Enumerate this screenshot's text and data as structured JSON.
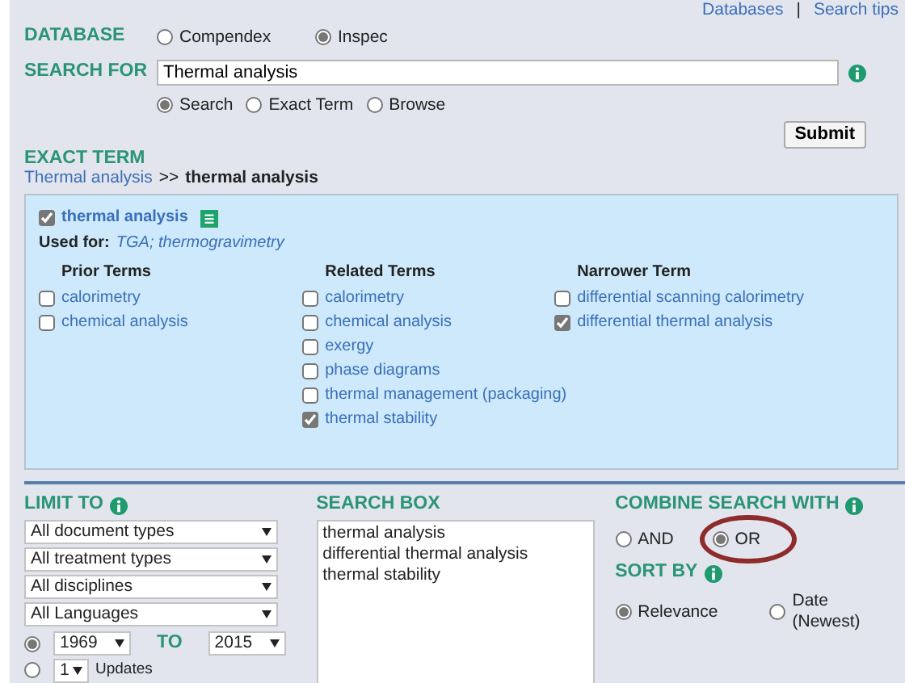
{
  "top_links": {
    "items": [
      "Databases",
      "Search tips"
    ],
    "separator": "|"
  },
  "database": {
    "label": "DATABASE",
    "options": [
      {
        "label": "Compendex",
        "selected": false
      },
      {
        "label": "Inspec",
        "selected": true
      }
    ]
  },
  "search_for": {
    "label": "SEARCH FOR",
    "value": "Thermal analysis",
    "options": [
      {
        "label": "Search",
        "selected": true
      },
      {
        "label": "Exact Term",
        "selected": false
      },
      {
        "label": "Browse",
        "selected": false
      }
    ],
    "submit": "Submit"
  },
  "exact_term": {
    "heading": "EXACT TERM",
    "breadcrumb_link": "Thermal analysis",
    "breadcrumb_sep": ">>",
    "current": "thermal analysis"
  },
  "term_box": {
    "term": {
      "label": "thermal analysis",
      "checked": true
    },
    "used_for_label": "Used for:",
    "used_for_value": "TGA; thermogravimetry",
    "columns": [
      {
        "heading": "Prior Terms",
        "items": [
          {
            "label": "calorimetry",
            "checked": false
          },
          {
            "label": "chemical analysis",
            "checked": false
          }
        ]
      },
      {
        "heading": "Related Terms",
        "items": [
          {
            "label": "calorimetry",
            "checked": false
          },
          {
            "label": "chemical analysis",
            "checked": false
          },
          {
            "label": "exergy",
            "checked": false
          },
          {
            "label": "phase diagrams",
            "checked": false
          },
          {
            "label": "thermal management (packaging)",
            "checked": false
          },
          {
            "label": "thermal stability",
            "checked": true
          }
        ]
      },
      {
        "heading": "Narrower Term",
        "items": [
          {
            "label": "differential scanning calorimetry",
            "checked": false
          },
          {
            "label": "differential thermal analysis",
            "checked": true
          }
        ]
      }
    ]
  },
  "limit_to": {
    "heading": "LIMIT TO",
    "selects": [
      "All document types",
      "All treatment types",
      "All disciplines",
      "All Languages"
    ],
    "year_range": {
      "selected": true,
      "from": "1969",
      "to_label": "TO",
      "to": "2015"
    },
    "updates": {
      "selected": false,
      "value": "1",
      "label": "Updates"
    }
  },
  "search_box": {
    "heading": "SEARCH BOX",
    "lines": [
      "thermal analysis",
      "differential thermal analysis",
      "thermal stability"
    ]
  },
  "combine": {
    "heading": "COMBINE SEARCH WITH",
    "options": [
      {
        "label": "AND",
        "selected": false
      },
      {
        "label": "OR",
        "selected": true
      }
    ]
  },
  "sort_by": {
    "heading": "SORT BY",
    "options": [
      {
        "label": "Relevance",
        "selected": true
      },
      {
        "label": "Date (Newest)",
        "selected": false
      }
    ]
  }
}
